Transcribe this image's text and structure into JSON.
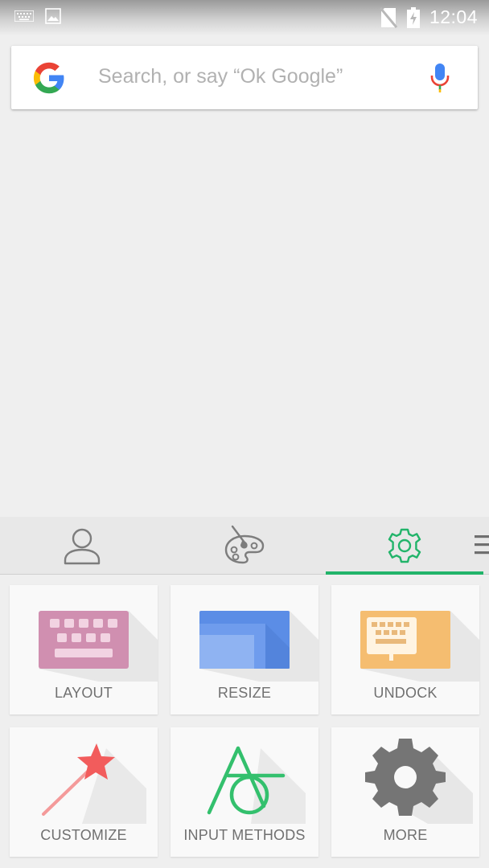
{
  "status_bar": {
    "time": "12:04",
    "icons": [
      "keyboard-icon",
      "image-icon",
      "no-sim-icon",
      "battery-charging-icon"
    ]
  },
  "search": {
    "placeholder": "Search, or say “Ok Google”",
    "icons": [
      "google-logo",
      "mic-icon"
    ]
  },
  "toolbar": {
    "tabs": [
      {
        "icon": "person-icon",
        "selected": false
      },
      {
        "icon": "palette-icon",
        "selected": false
      },
      {
        "icon": "gear-icon",
        "selected": true
      }
    ],
    "accent_color": "#22b46a",
    "overflow_icon": "menu-icon"
  },
  "tiles": [
    {
      "label": "LAYOUT",
      "icon": "keyboard-layout-icon",
      "color": "#d08fb0"
    },
    {
      "label": "RESIZE",
      "icon": "resize-icon",
      "color": "#5b8de6"
    },
    {
      "label": "UNDOCK",
      "icon": "undock-keyboard-icon",
      "color": "#f5bd70"
    },
    {
      "label": "CUSTOMIZE",
      "icon": "magic-wand-icon",
      "color": "#f25c5c"
    },
    {
      "label": "INPUT METHODS",
      "icon": "input-methods-icon",
      "color": "#33c06d"
    },
    {
      "label": "MORE",
      "icon": "gear-icon",
      "color": "#757575"
    }
  ]
}
